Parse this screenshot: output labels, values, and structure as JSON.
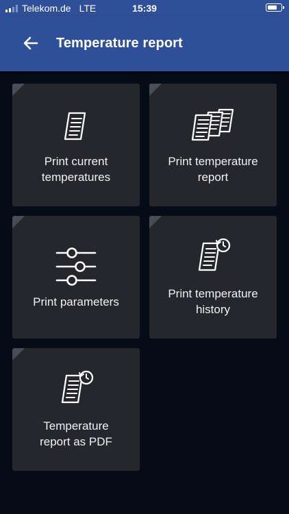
{
  "status_bar": {
    "carrier": "Telekom.de",
    "network": "LTE",
    "time": "15:39"
  },
  "app_bar": {
    "title": "Temperature report"
  },
  "tiles": [
    {
      "label": "Print current\ntemperatures"
    },
    {
      "label": "Print temperature\nreport"
    },
    {
      "label": "Print parameters"
    },
    {
      "label": "Print temperature\nhistory"
    },
    {
      "label": "Temperature\nreport as PDF"
    }
  ],
  "colors": {
    "app_bar": "#2f4f99",
    "background": "#060b18",
    "tile": "#25272d"
  }
}
